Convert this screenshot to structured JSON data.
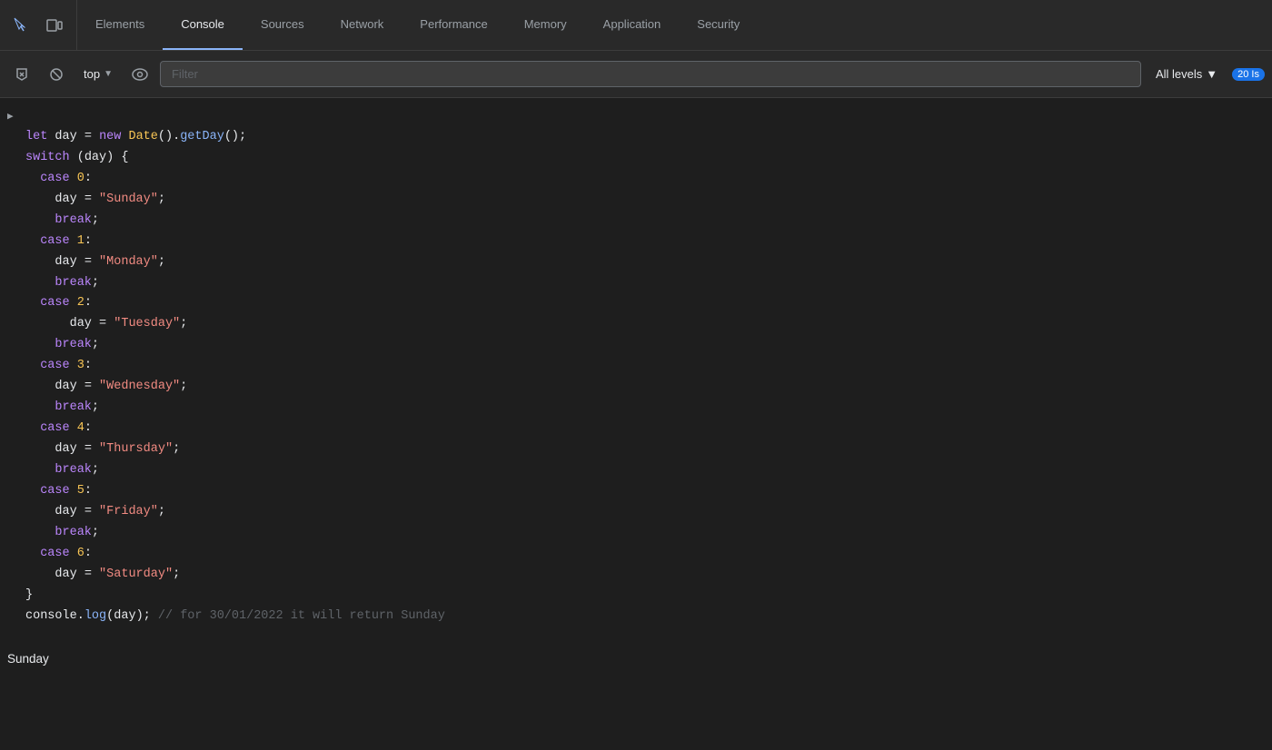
{
  "tabs": {
    "items": [
      {
        "label": "Elements",
        "active": false
      },
      {
        "label": "Console",
        "active": true
      },
      {
        "label": "Sources",
        "active": false
      },
      {
        "label": "Network",
        "active": false
      },
      {
        "label": "Performance",
        "active": false
      },
      {
        "label": "Memory",
        "active": false
      },
      {
        "label": "Application",
        "active": false
      },
      {
        "label": "Security",
        "active": false
      }
    ]
  },
  "toolbar": {
    "top_label": "top",
    "filter_placeholder": "Filter",
    "levels_label": "All levels",
    "badge_count": "20 Is"
  },
  "code": {
    "arrow": "▶",
    "line1": "let day = new Date().getDay();",
    "line2": "switch (day) {",
    "case0": "case 0:",
    "case0_assign": "day = \"Sunday\";",
    "case0_break": "break;",
    "case1": "case 1:",
    "case1_assign": "day = \"Monday\";",
    "case1_break": "break;",
    "case2": "case 2:",
    "case2_assign": "day = \"Tuesday\";",
    "case2_break": "break;",
    "case3": "case 3:",
    "case3_assign": "day = \"Wednesday\";",
    "case3_break": "break;",
    "case4": "case 4:",
    "case4_assign": "day = \"Thursday\";",
    "case4_break": "break;",
    "case5": "case 5:",
    "case5_assign": "day = \"Friday\";",
    "case5_break": "break;",
    "case6": "case 6:",
    "case6_assign": "day = \"Saturday\";",
    "close_brace": "}",
    "console_log": "console.log(day); // for 30/01/2022 it will return Sunday",
    "output": "Sunday"
  }
}
